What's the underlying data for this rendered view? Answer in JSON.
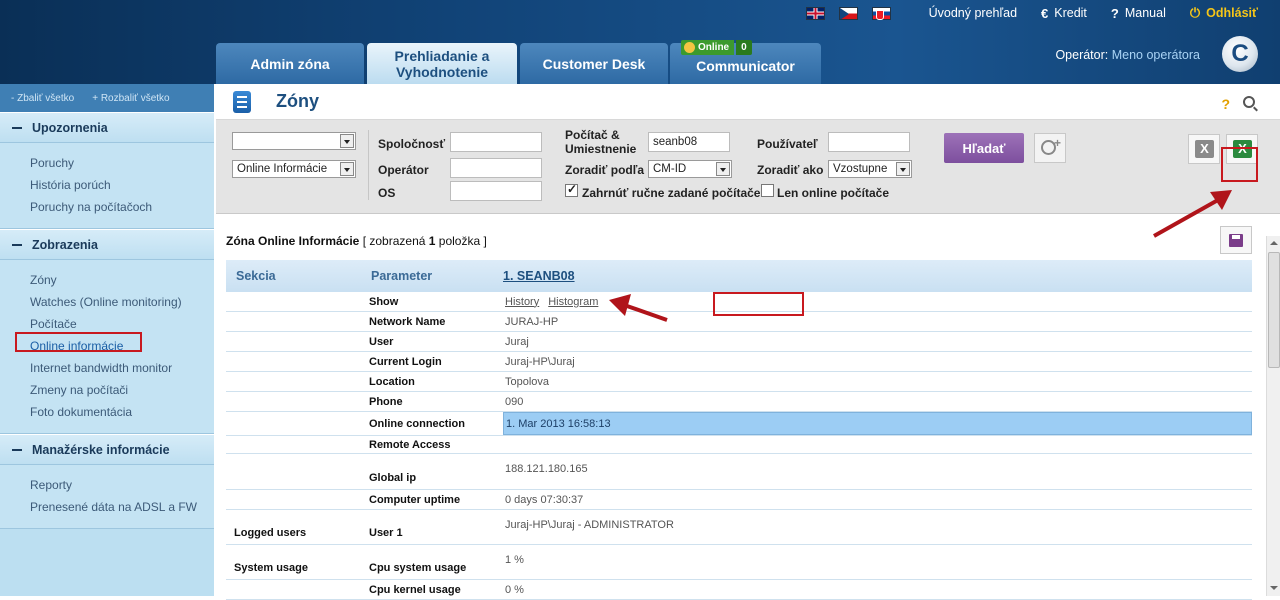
{
  "topbar": {
    "flags": [
      "English",
      "Čeština",
      "Slovenčina"
    ],
    "links": [
      {
        "icon": "",
        "label": "Úvodný prehľad"
      },
      {
        "icon": "€",
        "label": "Kredit"
      },
      {
        "icon": "?",
        "label": "Manual"
      },
      {
        "icon": "⏻",
        "label": "Odhlásiť"
      }
    ]
  },
  "tabs": [
    {
      "label": "Admin zóna"
    },
    {
      "label": "Prehliadanie a Vyhodnotenie"
    },
    {
      "label": "Customer Desk"
    },
    {
      "label": "Communicator"
    }
  ],
  "online_badge": {
    "label": "Online",
    "count": "0"
  },
  "operator": {
    "prefix": "Operátor:",
    "name": "Meno operátora"
  },
  "logo": {
    "letter": "C"
  },
  "sidebar": {
    "collapse_all": "- Zbaliť všetko",
    "expand_all": "+ Rozbaliť všetko",
    "sections": [
      {
        "title": "Upozornenia",
        "items": [
          "Poruchy",
          "História porúch",
          "Poruchy na počítačoch"
        ]
      },
      {
        "title": "Zobrazenia",
        "items": [
          "Zóny",
          "Watches (Online monitoring)",
          "Počítače",
          "Online informácie",
          "Internet bandwidth monitor",
          "Zmeny na počítači",
          "Foto dokumentácia"
        ]
      },
      {
        "title": "Manažérske informácie",
        "items": [
          "Reporty",
          "Prenesené dáta na ADSL a FW"
        ]
      }
    ],
    "active_item": "Online informácie"
  },
  "page": {
    "title": "Zóny",
    "help": "?"
  },
  "filters": {
    "select1": "",
    "select2": "Online Informácie",
    "company_label": "Spoločnosť",
    "operator_label": "Operátor",
    "os_label": "OS",
    "computer_label": "Počítač & Umiestnenie",
    "computer_value": "seanb08",
    "sort_by_label": "Zoradiť podľa",
    "sort_by_value": "CM-ID",
    "include_manual_label": "Zahrnúť ručne zadané počítače",
    "include_manual_checked": true,
    "user_label": "Používateľ",
    "sort_as_label": "Zoradiť ako",
    "sort_as_value": "Vzostupne",
    "online_only_label": "Len online počítače",
    "online_only_checked": false,
    "search_button": "Hľadať"
  },
  "results": {
    "zone_label": "Zóna Online Informácie",
    "shown_prefix": "[ zobrazená",
    "shown_count": "1",
    "shown_suffix": "položka ]"
  },
  "table": {
    "headers": {
      "section": "Sekcia",
      "parameter": "Parameter",
      "computer": "1. SEANB08"
    },
    "rows": [
      {
        "section": "",
        "parameter": "Show",
        "value": "",
        "links": [
          "History",
          "Histogram"
        ]
      },
      {
        "section": "",
        "parameter": "Network Name",
        "value": "JURAJ-HP"
      },
      {
        "section": "",
        "parameter": "User",
        "value": "Juraj"
      },
      {
        "section": "",
        "parameter": "Current Login",
        "value": "Juraj-HP\\Juraj"
      },
      {
        "section": "",
        "parameter": "Location",
        "value": "Topolova"
      },
      {
        "section": "",
        "parameter": "Phone",
        "value": "090"
      },
      {
        "section": "",
        "parameter": "Online connection",
        "value": "1. Mar 2013 16:58:13",
        "highlight": true
      },
      {
        "section": "",
        "parameter": "Remote Access",
        "value": ""
      },
      {
        "section": "",
        "parameter": "Global ip",
        "value": "188.121.180.165"
      },
      {
        "section": "",
        "parameter": "Computer uptime",
        "value": "0 days 07:30:37"
      },
      {
        "section": "Logged users",
        "parameter": "User 1",
        "value": "Juraj-HP\\Juraj - ADMINISTRATOR"
      },
      {
        "section": "System usage",
        "parameter": "Cpu system usage",
        "value": "1 %"
      },
      {
        "section": "",
        "parameter": "Cpu kernel usage",
        "value": "0 %"
      }
    ]
  },
  "colors": {
    "accent_red": "#c8191f",
    "header_blue": "#114377",
    "search_purple": "#8a5aab"
  }
}
